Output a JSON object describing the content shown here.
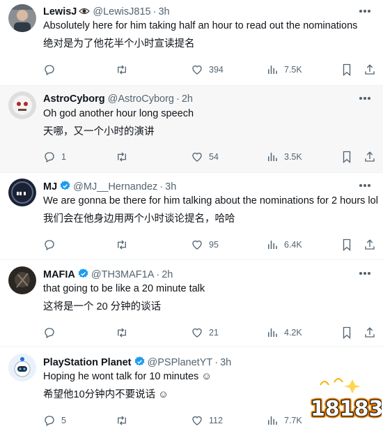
{
  "tweets": [
    {
      "name": "LewisJ",
      "handle": "@LewisJ815",
      "time": "3h",
      "verified": false,
      "text_en": "Absolutely here for him taking half an hour to read out the nominations",
      "text_zh": "绝对是为了他花半个小时宣读提名",
      "replies": "",
      "retweets": "",
      "likes": "394",
      "views": "7.5K"
    },
    {
      "name": "AstroCyborg",
      "handle": "@AstroCyborg",
      "time": "2h",
      "verified": false,
      "text_en": "Oh god another hour long speech",
      "text_zh": "天哪，又一个小时的演讲",
      "replies": "1",
      "retweets": "",
      "likes": "54",
      "views": "3.5K"
    },
    {
      "name": "MJ",
      "handle": "@MJ__Hernandez",
      "time": "3h",
      "verified": true,
      "text_en": "We are gonna be there for him talking about the nominations for 2 hours lol",
      "text_zh": "我们会在他身边用两个小时谈论提名，哈哈",
      "replies": "",
      "retweets": "",
      "likes": "95",
      "views": "6.4K"
    },
    {
      "name": "MAFIA",
      "handle": "@TH3MAF1A",
      "time": "2h",
      "verified": true,
      "text_en": "that going to be like a 20 minute talk",
      "text_zh": "这将是一个 20 分钟的谈话",
      "replies": "",
      "retweets": "",
      "likes": "21",
      "views": "4.2K"
    },
    {
      "name": "PlayStation Planet",
      "handle": "@PSPlanetYT",
      "time": "3h",
      "verified": true,
      "text_en": "Hoping he wont talk for 10 minutes ☺",
      "text_zh": "希望他10分钟内不要说话 ☺",
      "replies": "5",
      "retweets": "",
      "likes": "112",
      "views": "7.7K"
    }
  ],
  "watermark": {
    "text": "18183"
  },
  "colors": {
    "text": "#0f1419",
    "meta": "#536471",
    "verified": "#1d9bf0",
    "divider": "#eff3f4"
  },
  "icons": [
    "reply-icon",
    "retweet-icon",
    "like-icon",
    "views-icon",
    "bookmark-icon",
    "share-icon",
    "more-icon",
    "verified-icon",
    "eye-emoji-icon"
  ]
}
